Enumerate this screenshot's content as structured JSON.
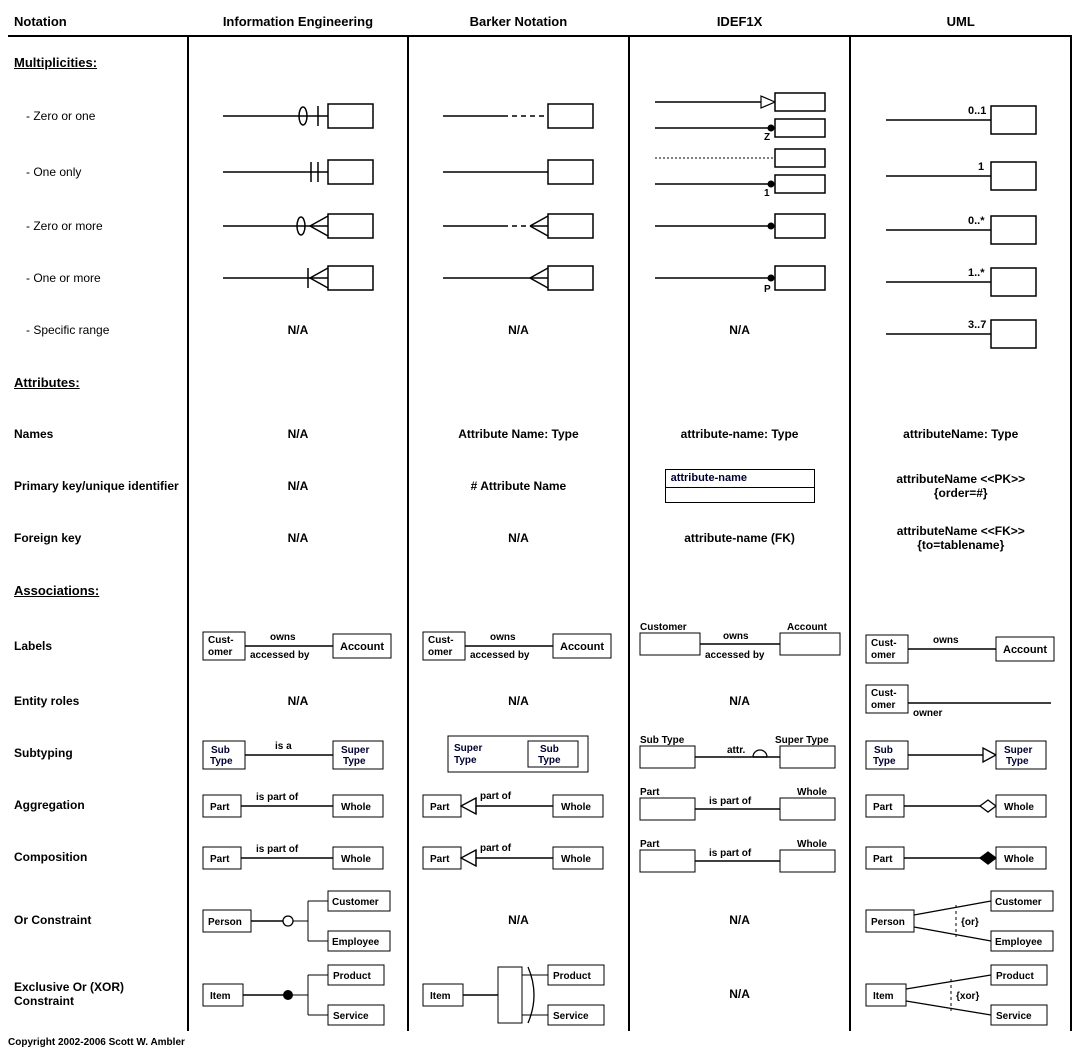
{
  "headers": {
    "notation": "Notation",
    "ie": "Information Engineering",
    "barker": "Barker Notation",
    "idef": "IDEF1X",
    "uml": "UML"
  },
  "sections": {
    "mult": "Multiplicities:",
    "attr": "Attributes:",
    "assoc": "Associations:"
  },
  "rows": {
    "zero_one": "- Zero or one",
    "one_only": "- One only",
    "zero_more": "- Zero or more",
    "one_more": "- One or more",
    "specific": "- Specific range",
    "names": "Names",
    "pk": "Primary key/unique identifier",
    "fk": "Foreign key",
    "labels": "Labels",
    "roles": "Entity roles",
    "subtype": "Subtyping",
    "agg": "Aggregation",
    "comp": "Composition",
    "or": "Or Constraint",
    "xor": "Exclusive Or (XOR) Constraint"
  },
  "na": "N/A",
  "uml_mult": {
    "zero_one": "0..1",
    "one_only": "1",
    "zero_more": "0..*",
    "one_more": "1..*",
    "specific": "3..7"
  },
  "attr_text": {
    "barker_name": "Attribute Name: Type",
    "idef_name": "attribute-name: Type",
    "uml_name": "attributeName: Type",
    "barker_pk": "# Attribute Name",
    "idef_pk": "attribute-name",
    "uml_pk_1": "attributeName <<PK>>",
    "uml_pk_2": "{order=#}",
    "idef_fk": "attribute-name (FK)",
    "uml_fk_1": "attributeName <<FK>>",
    "uml_fk_2": "{to=tablename}"
  },
  "diagram_labels": {
    "customer": "Customer",
    "cust_omer": "Cust-\nomer",
    "account": "Account",
    "owns": "owns",
    "accessed_by": "accessed by",
    "owner": "owner",
    "sub_type": "Sub\nType",
    "super_type": "Super\nType",
    "sub_type_h": "Sub Type",
    "super_type_h": "Super Type",
    "is_a": "is a",
    "attr_": "attr.",
    "part": "Part",
    "whole": "Whole",
    "is_part_of": "is part of",
    "part_of": "part of",
    "person": "Person",
    "customer_s": "Customer",
    "employee": "Employee",
    "item": "Item",
    "product": "Product",
    "service": "Service",
    "or": "{or}",
    "xor": "{xor}",
    "z": "Z",
    "one": "1",
    "p": "P"
  },
  "copyright": "Copyright 2002-2006 Scott W. Ambler"
}
